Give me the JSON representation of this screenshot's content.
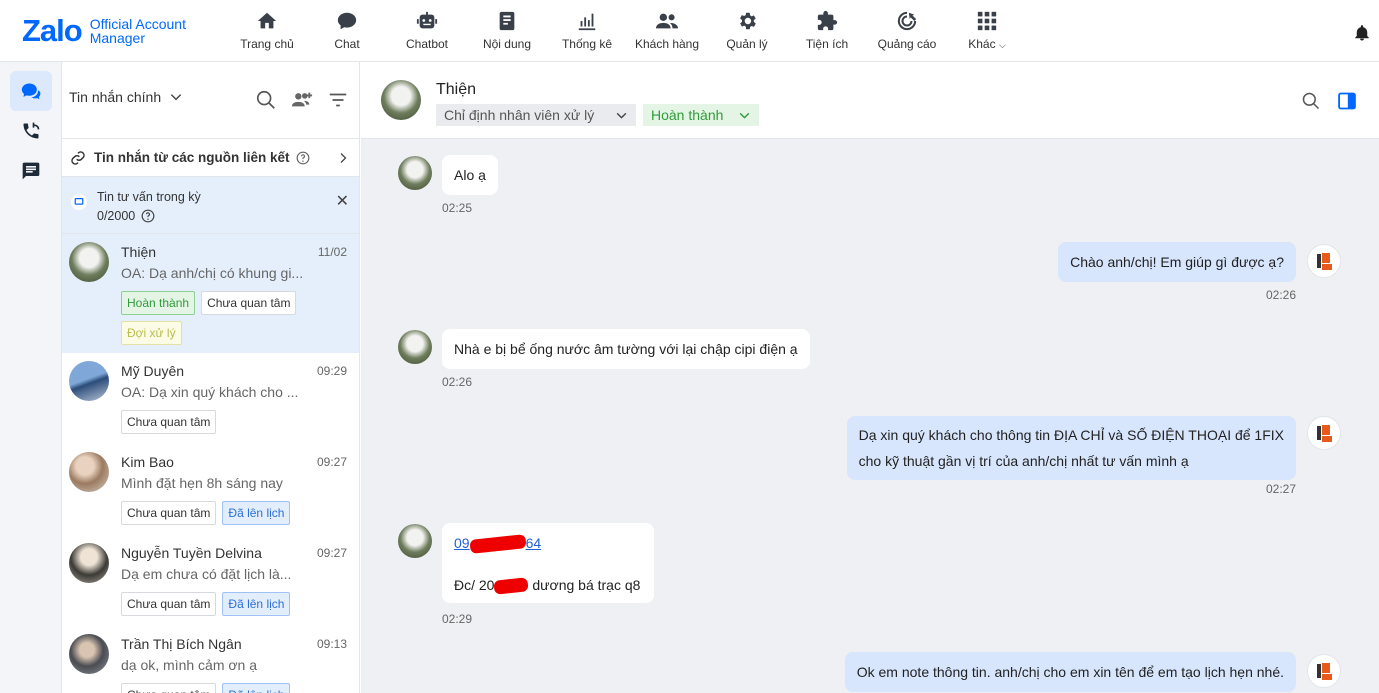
{
  "brand": {
    "logo": "Zalo",
    "sub_line1": "Official Account",
    "sub_line2": "Manager",
    "color": "#0068ff"
  },
  "nav": [
    {
      "label": "Trang chủ",
      "icon": "home-icon"
    },
    {
      "label": "Chat",
      "icon": "chat-icon"
    },
    {
      "label": "Chatbot",
      "icon": "robot-icon"
    },
    {
      "label": "Nội dung",
      "icon": "article-icon"
    },
    {
      "label": "Thống kê",
      "icon": "chart-icon"
    },
    {
      "label": "Khách hàng",
      "icon": "users-icon"
    },
    {
      "label": "Quản lý",
      "icon": "gear-icon"
    },
    {
      "label": "Tiện ích",
      "icon": "puzzle-icon"
    },
    {
      "label": "Quảng cáo",
      "icon": "megaphone-icon"
    },
    {
      "label": "Khác",
      "icon": "grid-icon"
    }
  ],
  "list": {
    "title": "Tin nhắn chính",
    "linked_sources": "Tin nhắn từ các nguồn liên kết",
    "quota_title": "Tin tư vấn trong kỳ",
    "quota_count": "0/2000"
  },
  "conversations": [
    {
      "name": "Thiện",
      "time": "11/02",
      "preview": "OA: Dạ anh/chị có khung gi...",
      "tags": [
        "Hoàn thành",
        "Chưa quan tâm",
        "Đợi xử lý"
      ]
    },
    {
      "name": "Mỹ Duyên",
      "time": "09:29",
      "preview": "OA: Dạ xin quý khách cho ...",
      "tags": [
        "Chưa quan tâm"
      ]
    },
    {
      "name": "Kim Bao",
      "time": "09:27",
      "preview": "Mình đặt hẹn 8h sáng nay",
      "tags": [
        "Chưa quan tâm",
        "Đã lên lịch"
      ]
    },
    {
      "name": "Nguyễn Tuyền Delvina",
      "time": "09:27",
      "preview": "Dạ em chưa có đặt lịch là...",
      "tags": [
        "Chưa quan tâm",
        "Đã lên lịch"
      ]
    },
    {
      "name": "Trần Thị Bích Ngân",
      "time": "09:13",
      "preview": "dạ ok, mình cảm ơn ạ",
      "tags": [
        "Chưa quan tâm",
        "Đã lên lịch"
      ]
    }
  ],
  "chat": {
    "name": "Thiện",
    "assign_placeholder": "Chỉ định nhân viên xử lý",
    "status": "Hoàn thành",
    "messages": [
      {
        "text": "Alo ạ",
        "time": "02:25"
      },
      {
        "text": "Chào anh/chị! Em giúp gì được ạ?",
        "time": "02:26"
      },
      {
        "text": "Nhà e bị bể ống nước âm tường với lại chập cipi điện ạ",
        "time": "02:26"
      },
      {
        "line1": "Dạ xin quý khách cho thông tin ĐỊA CHỈ và SỐ ĐIỆN THOẠI để 1FIX",
        "line2": "cho kỹ thuật gần vị trí của anh/chị nhất tư vấn mình ạ",
        "time": "02:27"
      },
      {
        "phone_start": "09",
        "phone_end": "64",
        "addr_start": "Đc/ 20",
        "addr_end": " dương bá trạc q8",
        "time": "02:29"
      },
      {
        "text": "Ok em note thông tin. anh/chị cho em xin tên để em tạo lịch hẹn nhé."
      }
    ]
  }
}
